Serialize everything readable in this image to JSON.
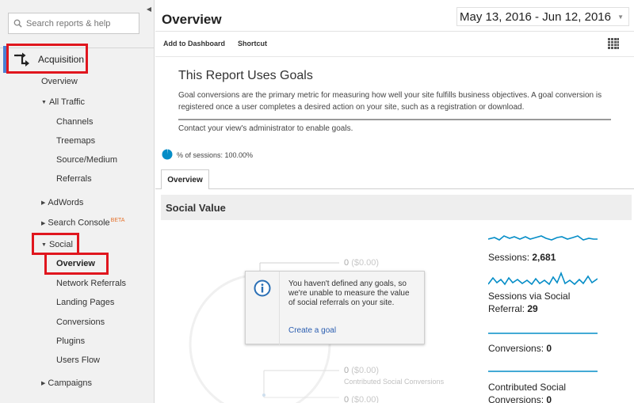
{
  "sidebar": {
    "search_placeholder": "Search reports & help",
    "acquisition_label": "Acquisition",
    "items": {
      "overview": "Overview",
      "all_traffic": "All Traffic",
      "channels": "Channels",
      "treemaps": "Treemaps",
      "source_medium": "Source/Medium",
      "referrals": "Referrals",
      "adwords": "AdWords",
      "search_console": "Search Console",
      "search_console_badge": "BETA",
      "social": "Social",
      "social_overview": "Overview",
      "network_referrals": "Network Referrals",
      "landing_pages": "Landing Pages",
      "conversions": "Conversions",
      "plugins": "Plugins",
      "users_flow": "Users Flow",
      "campaigns": "Campaigns"
    }
  },
  "header": {
    "title": "Overview",
    "date_range": "May 13, 2016 - Jun 12, 2016"
  },
  "toolbar": {
    "add_to_dashboard": "Add to Dashboard",
    "shortcut": "Shortcut"
  },
  "goals_notice": {
    "title": "This Report Uses Goals",
    "text": "Goal conversions are the primary metric for measuring how well your site fulfills business objectives. A goal conversion is registered once a user completes a desired action on your site, such as a registration or download.",
    "contact": "Contact your view's administrator to enable goals."
  },
  "sessions_pct": "% of sessions: 100.00%",
  "tab": {
    "overview": "Overview"
  },
  "section_title": "Social Value",
  "diagram": {
    "top_value": "0",
    "top_money": "($0.00)",
    "mid_value": "0",
    "mid_money": "($0.00)",
    "mid_caption": "Contributed Social Conversions",
    "bottom_value": "0",
    "bottom_money": "($0.00)"
  },
  "tooltip": {
    "text": "You haven't defined any goals, so we're unable to measure the value of social referrals on your site.",
    "link": "Create a goal"
  },
  "metrics": {
    "sessions_label": "Sessions:",
    "sessions_value": "2,681",
    "social_sessions_label_1": "Sessions via Social",
    "social_sessions_label_2": "Referral:",
    "social_sessions_value": "29",
    "conversions_label": "Conversions:",
    "conversions_value": "0",
    "contributed_label_1": "Contributed Social",
    "contributed_label_2": "Conversions:",
    "contributed_value": "0"
  },
  "colors": {
    "accent_red": "#e0161e",
    "sidebar_accent": "#4a7fd4",
    "sparkline": "#058dc7",
    "link": "#2a5db0"
  }
}
